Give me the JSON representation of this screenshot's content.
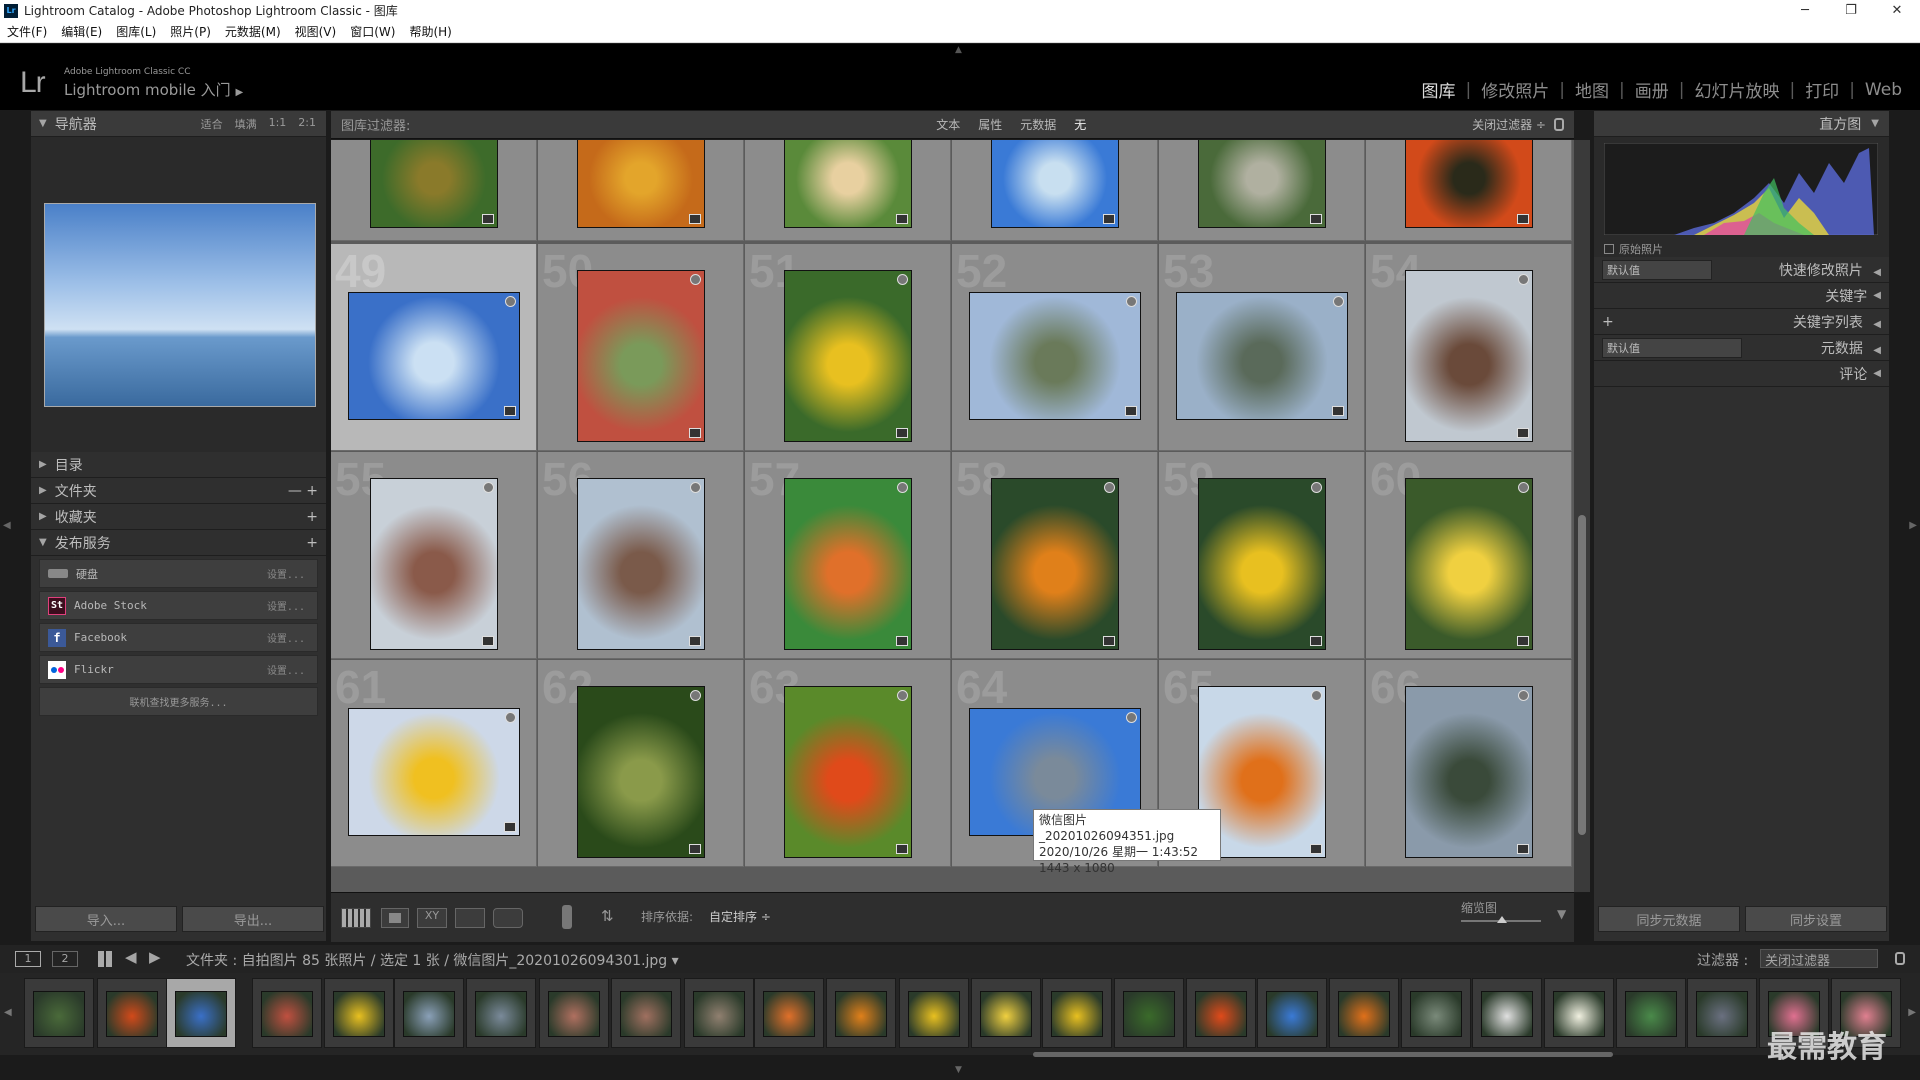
{
  "window": {
    "title": "Lightroom Catalog - Adobe Photoshop Lightroom Classic - 图库",
    "app_icon": "Lr"
  },
  "menu": [
    "文件(F)",
    "编辑(E)",
    "图库(L)",
    "照片(P)",
    "元数据(M)",
    "视图(V)",
    "窗口(W)",
    "帮助(H)"
  ],
  "identity": {
    "logo": "Lr",
    "product_small": "Adobe Lightroom Classic CC",
    "product_big": "Lightroom mobile 入门",
    "arrow": "▶"
  },
  "modules": [
    {
      "label": "图库",
      "active": true
    },
    {
      "label": "修改照片"
    },
    {
      "label": "地图"
    },
    {
      "label": "画册"
    },
    {
      "label": "幻灯片放映"
    },
    {
      "label": "打印"
    },
    {
      "label": "Web"
    }
  ],
  "left": {
    "navigator": {
      "title": "导航器",
      "options": [
        "适合",
        "填满",
        "1:1",
        "2:1"
      ]
    },
    "sections": [
      {
        "label": "目录",
        "icons": ""
      },
      {
        "label": "文件夹",
        "icons": "— +"
      },
      {
        "label": "收藏夹",
        "icons": "+"
      },
      {
        "label": "发布服务",
        "icons": "+"
      }
    ],
    "services": [
      {
        "label": "硬盘",
        "setup": "设置..."
      },
      {
        "label": "Adobe Stock",
        "setup": "设置..."
      },
      {
        "label": "Facebook",
        "setup": "设置..."
      },
      {
        "label": "Flickr",
        "setup": "设置..."
      }
    ],
    "find_more": "联机查找更多服务...",
    "import": "导入...",
    "export": "导出..."
  },
  "filter": {
    "label": "图库过滤器:",
    "tabs": [
      "文本",
      "属性",
      "元数据",
      "无"
    ],
    "close": "关闭过滤器 ÷"
  },
  "grid": {
    "rows": [
      {
        "indices": [
          "",
          "",
          "",
          "",
          "",
          ""
        ]
      },
      {
        "indices": [
          "49",
          "50",
          "51",
          "52",
          "53",
          "54"
        ]
      },
      {
        "indices": [
          "55",
          "56",
          "57",
          "58",
          "59",
          "60"
        ]
      },
      {
        "indices": [
          "61",
          "62",
          "63",
          "64",
          "65",
          "66"
        ]
      }
    ]
  },
  "tooltip": {
    "line1": "微信图片_20201026094351.jpg",
    "line2": "2020/10/26 星期一 1:43:52",
    "line3": "1443 x 1080"
  },
  "toolbar": {
    "sort_label": "排序依据:",
    "sort_value": "自定排序 ÷",
    "thumb_label": "缩览图"
  },
  "right": {
    "histogram": "直方图",
    "original": "原始照片",
    "panels": [
      {
        "label": "快速修改照片",
        "preset": "默认值"
      },
      {
        "label": "关键字",
        "preset": ""
      },
      {
        "label": "关键字列表",
        "preset": "+"
      },
      {
        "label": "元数据",
        "preset": "默认值"
      },
      {
        "label": "评论",
        "preset": ""
      }
    ],
    "sync_meta": "同步元数据",
    "sync_settings": "同步设置"
  },
  "filmbar": {
    "page1": "1",
    "page2": "2",
    "path": "文件夹 : 自拍图片   85 张照片 / 选定 1 张 / 微信图片_20201026094301.jpg ▾",
    "filter_label": "过滤器 :",
    "filter_value": "关闭过滤器"
  },
  "watermark": "最需教育"
}
